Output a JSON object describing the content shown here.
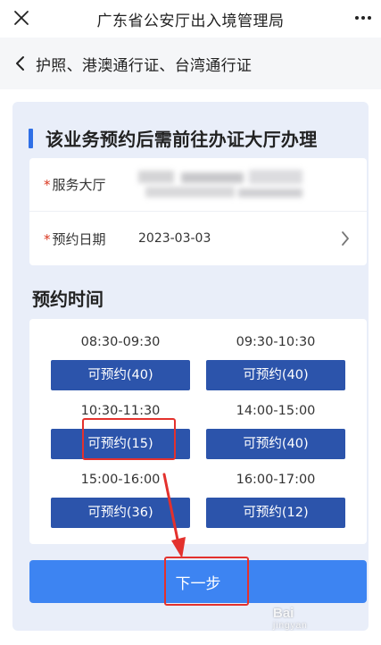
{
  "app": {
    "title": "广东省公安厅出入境管理局"
  },
  "nav": {
    "title": "护照、港澳通行证、台湾通行证"
  },
  "notice": {
    "text": "该业务预约后需前往办证大厅办理"
  },
  "form": {
    "required_mark": "*",
    "hall_label": "服务大厅",
    "hall_value": "",
    "date_label": "预约日期",
    "date_value": "2023-03-03"
  },
  "booking": {
    "title": "预约时间",
    "slots": [
      {
        "time": "08:30-09:30",
        "label": "可预约(40)",
        "available": 40
      },
      {
        "time": "09:30-10:30",
        "label": "可预约(40)",
        "available": 40
      },
      {
        "time": "10:30-11:30",
        "label": "可预约(15)",
        "available": 15
      },
      {
        "time": "14:00-15:00",
        "label": "可预约(40)",
        "available": 40
      },
      {
        "time": "15:00-16:00",
        "label": "可预约(36)",
        "available": 36
      },
      {
        "time": "16:00-17:00",
        "label": "可预约(12)",
        "available": 12
      }
    ]
  },
  "actions": {
    "next_label": "下一步"
  },
  "watermark": {
    "text": "Bai",
    "sub": "jingyan"
  },
  "colors": {
    "accent": "#2f6fe6",
    "slot_button": "#2c54ab",
    "primary_button": "#3d84f2",
    "annotation_red": "#e3312d",
    "required_red": "#d9361f",
    "panel_bg": "#e9eef9"
  },
  "icons": {
    "close": "close-icon",
    "more": "more-icon",
    "back": "chevron-left-icon",
    "row_arrow": "chevron-right-icon"
  }
}
